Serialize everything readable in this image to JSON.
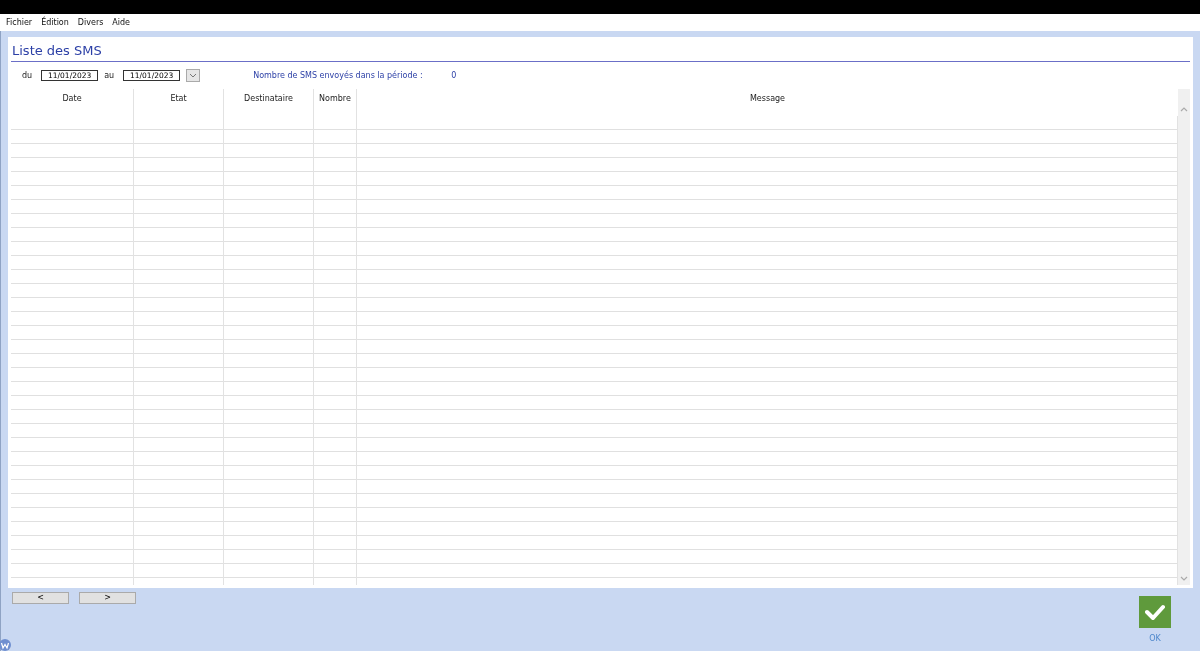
{
  "menu": [
    "Fichier",
    "Édition",
    "Divers",
    "Aide"
  ],
  "title": "Liste des SMS",
  "filter": {
    "from_label": "du",
    "from_value": "11/01/2023",
    "to_label": "au",
    "to_value": "11/01/2023",
    "count_label": "Nombre de SMS envoyés dans la période :",
    "count_value": "0"
  },
  "table": {
    "columns": [
      "Date",
      "Etat",
      "Destinataire",
      "Nombre",
      "Message"
    ]
  },
  "nav_buttons": [
    "<",
    ">"
  ],
  "ok_button": {
    "label": "OK"
  }
}
